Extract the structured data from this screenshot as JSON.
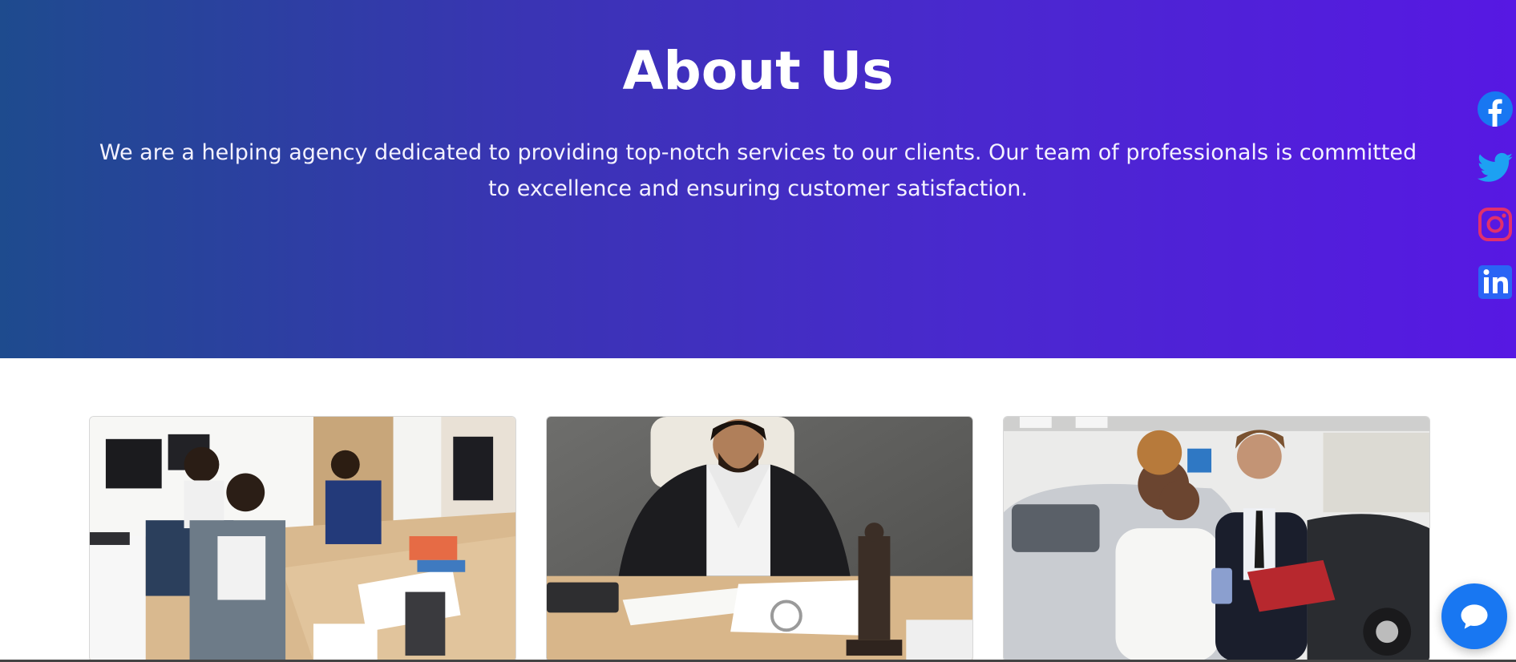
{
  "hero": {
    "title": "About Us",
    "description": "We are a helping agency dedicated to providing top-notch services to our clients. Our team of professionals is committed to excellence and ensuring customer satisfaction.",
    "gradient_start": "#1e4b8e",
    "gradient_end": "#5718e3"
  },
  "social": [
    {
      "icon": "facebook-icon",
      "color": "#1877f2"
    },
    {
      "icon": "twitter-icon",
      "color": "#1da1f2"
    },
    {
      "icon": "instagram-icon",
      "color": "#e1306c"
    },
    {
      "icon": "linkedin-icon",
      "color": "#2a64f5"
    }
  ],
  "cards": [
    {
      "image": "office-team-meeting-photo"
    },
    {
      "image": "lawyer-signing-documents-photo"
    },
    {
      "image": "car-dealership-consultation-photo"
    }
  ],
  "chat": {
    "icon": "chat-bubble-icon",
    "color": "#1877f2"
  }
}
